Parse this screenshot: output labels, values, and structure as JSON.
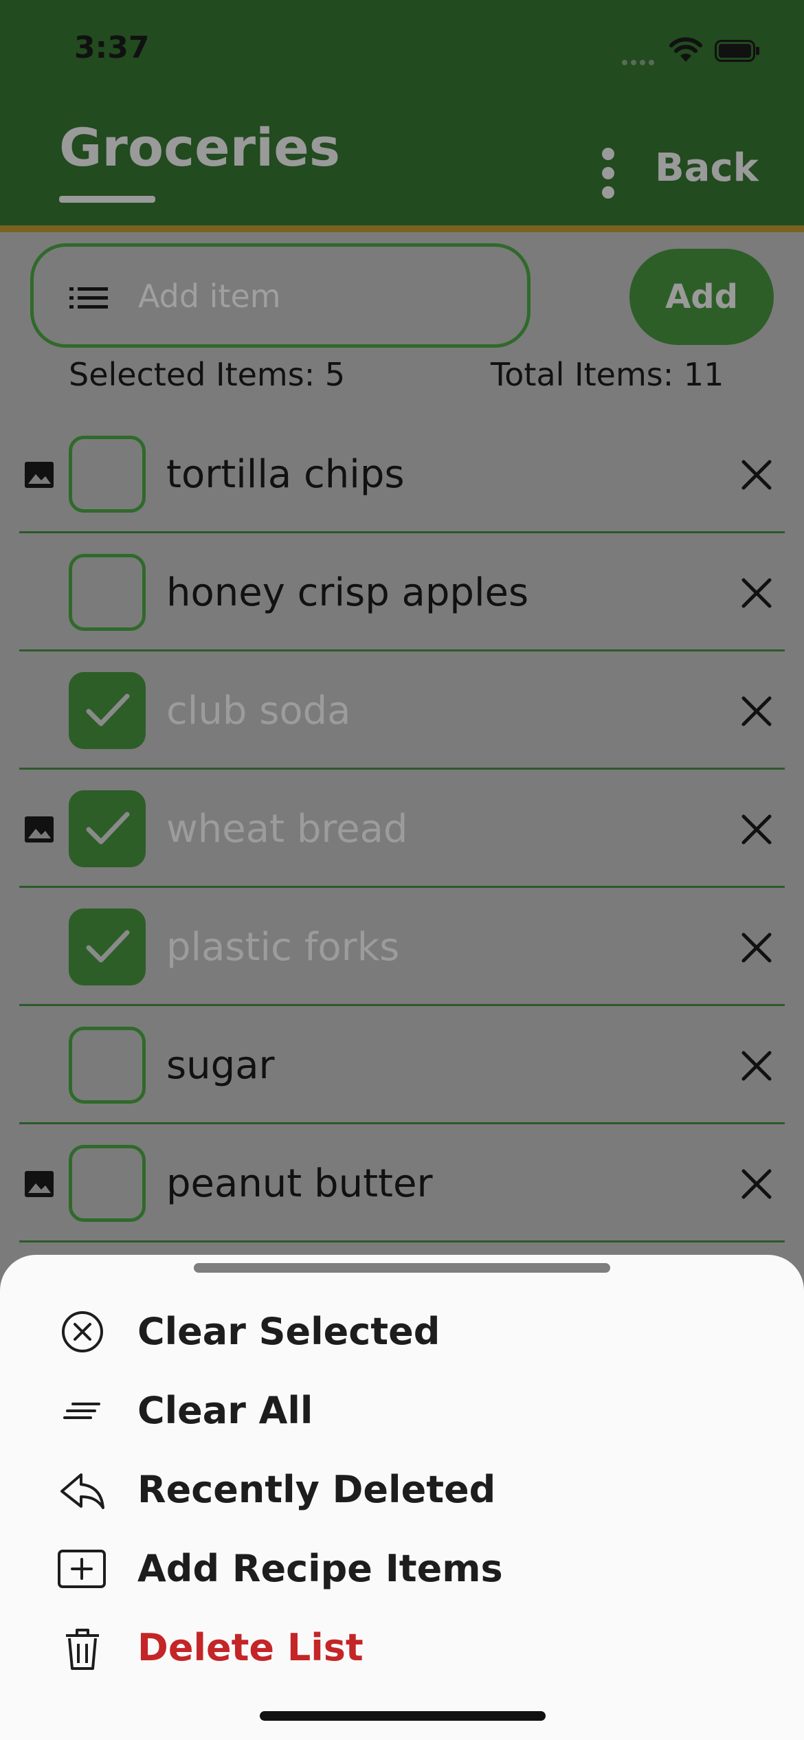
{
  "status_bar": {
    "time": "3:37"
  },
  "header": {
    "title": "Groceries",
    "back_label": "Back"
  },
  "add_item": {
    "placeholder": "Add item",
    "button_label": "Add"
  },
  "counts": {
    "selected": "Selected Items: 5",
    "total": "Total Items: 11"
  },
  "items": [
    {
      "label": "tortilla chips",
      "checked": false,
      "has_image": true
    },
    {
      "label": "honey crisp apples",
      "checked": false,
      "has_image": false
    },
    {
      "label": "club soda",
      "checked": true,
      "has_image": false
    },
    {
      "label": "wheat bread",
      "checked": true,
      "has_image": true
    },
    {
      "label": "plastic forks",
      "checked": true,
      "has_image": false
    },
    {
      "label": "sugar",
      "checked": false,
      "has_image": false
    },
    {
      "label": "peanut butter",
      "checked": false,
      "has_image": true
    }
  ],
  "menu": {
    "clear_selected": "Clear Selected",
    "clear_all": "Clear All",
    "recently_deleted": "Recently Deleted",
    "add_recipe_items": "Add Recipe Items",
    "delete_list": "Delete List"
  },
  "colors": {
    "header": "#224b1f",
    "accent": "#2d5e28",
    "danger": "#c42527",
    "overlay": "#7b7b7b",
    "sheet": "#fafafa"
  },
  "icons": {
    "list": "list-icon",
    "image": "image-icon",
    "remove": "close-icon",
    "clear_selected": "circle-x-icon",
    "clear_all": "lines-icon",
    "recently_deleted": "reply-arrow-icon",
    "add_recipe_items": "square-plus-icon",
    "delete_list": "trash-icon"
  }
}
